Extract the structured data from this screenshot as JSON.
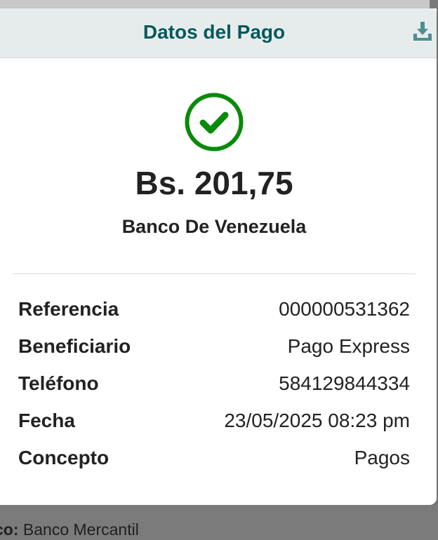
{
  "header": {
    "title": "Datos del Pago",
    "download_icon": "download-icon"
  },
  "receipt": {
    "status_icon": "check-circle-icon",
    "status_color": "#0a8a0a",
    "amount": "Bs. 201,75",
    "bank": "Banco De Venezuela",
    "details": [
      {
        "label": "Referencia",
        "value": "000000531362"
      },
      {
        "label": "Beneficiario",
        "value": "Pago Express"
      },
      {
        "label": "Teléfono",
        "value": "584129844334"
      },
      {
        "label": "Fecha",
        "value": "23/05/2025 08:23 pm"
      },
      {
        "label": "Concepto",
        "value": "Pagos"
      }
    ]
  },
  "background": {
    "label_partial": "co:",
    "value": "Banco Mercantil"
  },
  "colors": {
    "accent": "#06585c",
    "success": "#0a8a0a",
    "header_bg": "#e6ecec"
  }
}
